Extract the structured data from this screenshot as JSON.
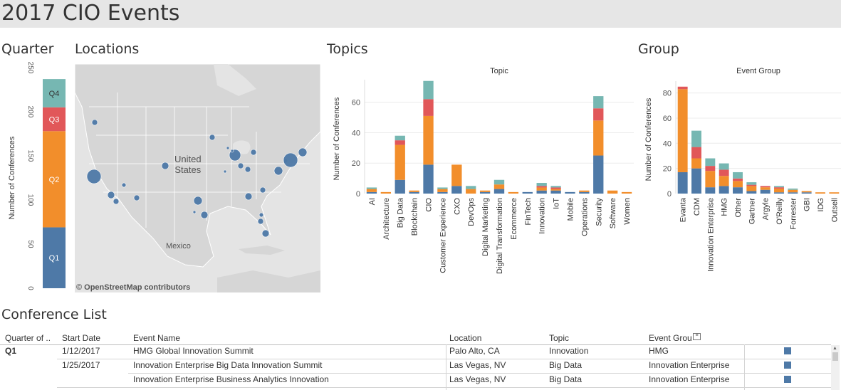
{
  "page": {
    "title": "2017 CIO Events"
  },
  "sections": {
    "quarter": "Quarter",
    "locations": "Locations",
    "topics": "Topics",
    "group": "Group",
    "conference_list": "Conference List"
  },
  "colors": {
    "q1": "#4e79a7",
    "q2": "#f28e2b",
    "q3": "#e15759",
    "q4": "#76b7b2"
  },
  "chart_data": [
    {
      "type": "bar",
      "subtype": "stacked-single",
      "ylabel": "Number of Conferences",
      "ylim": [
        0,
        250
      ],
      "yticks": [
        0,
        50,
        100,
        150,
        200,
        250
      ],
      "segments": [
        {
          "name": "Q1",
          "value": 69
        },
        {
          "name": "Q2",
          "value": 109
        },
        {
          "name": "Q3",
          "value": 27
        },
        {
          "name": "Q4",
          "value": 32
        }
      ]
    },
    {
      "type": "bar",
      "subtype": "stacked",
      "title": "Topic",
      "ylabel": "Number of Conferences",
      "ylim": [
        0,
        72
      ],
      "yticks": [
        0,
        20,
        40,
        60
      ],
      "categories": [
        "AI",
        "Architecture",
        "Big Data",
        "Blockchain",
        "CIO",
        "Customer Experience",
        "CXO",
        "DevOps",
        "Digital Marketing",
        "Digital Transformation",
        "Ecommerce",
        "FinTech",
        "Innovation",
        "IoT",
        "Mobile",
        "Operations",
        "Security",
        "Software",
        "Women"
      ],
      "series": [
        {
          "name": "Q1",
          "values": [
            1,
            0,
            9,
            1,
            19,
            1,
            5,
            0,
            1,
            3,
            0,
            1,
            2,
            2,
            1,
            1,
            25,
            0,
            0
          ]
        },
        {
          "name": "Q2",
          "values": [
            2,
            1,
            23,
            1,
            32,
            2,
            14,
            3,
            1,
            3,
            1,
            0,
            2,
            1,
            0,
            1,
            23,
            2,
            1
          ]
        },
        {
          "name": "Q3",
          "values": [
            0,
            0,
            3,
            0,
            11,
            0,
            0,
            0,
            0,
            0,
            0,
            0,
            1,
            1,
            0,
            0,
            8,
            0,
            0
          ]
        },
        {
          "name": "Q4",
          "values": [
            1,
            0,
            3,
            0,
            12,
            1,
            0,
            2,
            0,
            3,
            0,
            0,
            2,
            1,
            0,
            0,
            8,
            0,
            0
          ]
        }
      ]
    },
    {
      "type": "bar",
      "subtype": "stacked",
      "title": "Event Group",
      "ylabel": "Number of Conferences",
      "ylim": [
        0,
        86
      ],
      "yticks": [
        0,
        20,
        40,
        60,
        80
      ],
      "categories": [
        "Evanta",
        "CDM",
        "Innovation Enterprise",
        "HMG",
        "Other",
        "Gartner",
        "Argyle",
        "O'Reilly",
        "Forrester",
        "GBI",
        "IDG",
        "Outsell"
      ],
      "series": [
        {
          "name": "Q1",
          "values": [
            17,
            20,
            5,
            6,
            5,
            2,
            3,
            1,
            1,
            1,
            0,
            0
          ]
        },
        {
          "name": "Q2",
          "values": [
            66,
            8,
            13,
            8,
            5,
            4,
            2,
            3,
            2,
            1,
            1,
            1
          ]
        },
        {
          "name": "Q3",
          "values": [
            2,
            9,
            4,
            5,
            2,
            1,
            1,
            1,
            0,
            0,
            0,
            0
          ]
        },
        {
          "name": "Q4",
          "values": [
            0,
            13,
            6,
            5,
            5,
            2,
            0,
            1,
            1,
            0,
            0,
            0
          ]
        }
      ]
    }
  ],
  "map": {
    "labels": {
      "country": "United\nStates",
      "mexico": "Mexico"
    },
    "credit": "© OpenStreetMap contributors",
    "bubble_color": "#4e79a7",
    "land_color": "#d6d6d6",
    "water_color": "#e4e4e4"
  },
  "table": {
    "headers": [
      "Quarter of ..",
      "Start Date",
      "Event Name",
      "Location",
      "Topic",
      "Event Grou"
    ],
    "group_label": "Q1",
    "rows": [
      {
        "date": "1/12/2017",
        "event": "HMG Global Innovation Summit",
        "location": "Palo Alto, CA",
        "topic": "Innovation",
        "group": "HMG"
      },
      {
        "date": "1/25/2017",
        "event": "Innovation Enterprise Big Data Innovation Summit",
        "location": "Las Vegas, NV",
        "topic": "Big Data",
        "group": "Innovation Enterprise"
      },
      {
        "date": "",
        "event": "Innovation Enterprise Business Analytics Innovation",
        "location": "Las Vegas, NV",
        "topic": "Big Data",
        "group": "Innovation Enterprise"
      }
    ]
  }
}
